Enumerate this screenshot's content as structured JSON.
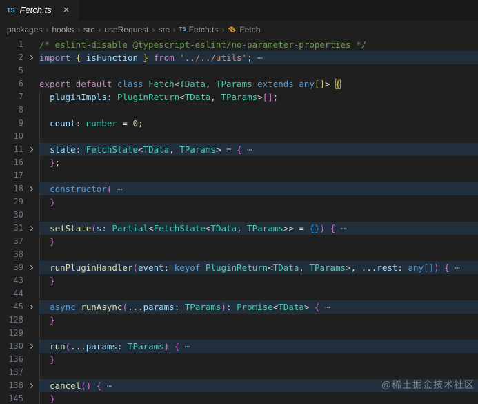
{
  "tab": {
    "icon": "TS",
    "title": "Fetch.ts",
    "close_label": "×"
  },
  "breadcrumb": {
    "separator": "›",
    "items": [
      {
        "label": "packages"
      },
      {
        "label": "hooks"
      },
      {
        "label": "src"
      },
      {
        "label": "useRequest"
      },
      {
        "label": "src"
      },
      {
        "label": "Fetch.ts",
        "icon": "typescript"
      },
      {
        "label": "Fetch",
        "icon": "class"
      }
    ]
  },
  "colors": {
    "editor_bg": "#1f1f1f",
    "tabstrip_bg": "#181818",
    "fold_highlight": "rgba(38,79,120,0.33)",
    "comment": "#6A9955",
    "keyword_control": "#C586C0",
    "keyword": "#569CD6",
    "type": "#4EC9B0",
    "variable": "#9CDCFE",
    "function": "#DCDCAA",
    "string": "#CE9178",
    "number_literal": "#B5CEA8",
    "punctuation": "#D4D4D4",
    "bracket_level1": "#FFD700",
    "bracket_level2": "#DA70D6",
    "bracket_level3": "#179FFF",
    "line_number": "#6e7681",
    "ts_icon": "#59a7d4",
    "class_icon": "#EE9D28"
  },
  "watermark": "@稀土掘金技术社区",
  "editor": {
    "lines": [
      {
        "num": "1",
        "seg": [
          [
            "/* eslint-disable @typescript-eslint/no-parameter-properties */",
            "comment"
          ]
        ]
      },
      {
        "num": "2",
        "fold": true,
        "hl": true,
        "seg": [
          [
            "import",
            "kwctl"
          ],
          [
            " ",
            "op"
          ],
          [
            "{",
            "b1"
          ],
          [
            " ",
            "op"
          ],
          [
            "isFunction",
            "var"
          ],
          [
            " ",
            "op"
          ],
          [
            "}",
            "b1"
          ],
          [
            " ",
            "op"
          ],
          [
            "from",
            "kwctl"
          ],
          [
            " ",
            "op"
          ],
          [
            "'../../utils'",
            "str"
          ],
          [
            ";",
            "op"
          ],
          [
            " ⋯",
            "fold"
          ]
        ]
      },
      {
        "num": "5",
        "seg": []
      },
      {
        "num": "6",
        "seg": [
          [
            "export",
            "kwctl"
          ],
          [
            " ",
            "op"
          ],
          [
            "default",
            "kwctl"
          ],
          [
            " ",
            "op"
          ],
          [
            "class",
            "kw"
          ],
          [
            " ",
            "op"
          ],
          [
            "Fetch",
            "type"
          ],
          [
            "<",
            "op"
          ],
          [
            "TData",
            "type"
          ],
          [
            ", ",
            "op"
          ],
          [
            "TParams",
            "type"
          ],
          [
            " ",
            "op"
          ],
          [
            "extends",
            "kw"
          ],
          [
            " ",
            "op"
          ],
          [
            "any",
            "kw"
          ],
          [
            "[]",
            "b1"
          ],
          [
            ">",
            "op"
          ],
          [
            " ",
            "op"
          ],
          [
            "{",
            "b1",
            "match"
          ]
        ]
      },
      {
        "num": "7",
        "guide": true,
        "seg": [
          [
            "  ",
            "op"
          ],
          [
            "pluginImpls",
            "var"
          ],
          [
            ":",
            "op"
          ],
          [
            " ",
            "op"
          ],
          [
            "PluginReturn",
            "type"
          ],
          [
            "<",
            "op"
          ],
          [
            "TData",
            "type"
          ],
          [
            ", ",
            "op"
          ],
          [
            "TParams",
            "type"
          ],
          [
            ">",
            "op"
          ],
          [
            "[]",
            "b2"
          ],
          [
            ";",
            "op"
          ]
        ]
      },
      {
        "num": "8",
        "guide": true,
        "seg": []
      },
      {
        "num": "9",
        "guide": true,
        "seg": [
          [
            "  ",
            "op"
          ],
          [
            "count",
            "var"
          ],
          [
            ":",
            "op"
          ],
          [
            " ",
            "op"
          ],
          [
            "number",
            "type"
          ],
          [
            " = ",
            "op"
          ],
          [
            "0",
            "num"
          ],
          [
            ";",
            "op"
          ]
        ]
      },
      {
        "num": "10",
        "guide": true,
        "seg": []
      },
      {
        "num": "11",
        "fold": true,
        "hl": true,
        "guide": true,
        "seg": [
          [
            "  ",
            "op"
          ],
          [
            "state",
            "var"
          ],
          [
            ":",
            "op"
          ],
          [
            " ",
            "op"
          ],
          [
            "FetchState",
            "type"
          ],
          [
            "<",
            "op"
          ],
          [
            "TData",
            "type"
          ],
          [
            ", ",
            "op"
          ],
          [
            "TParams",
            "type"
          ],
          [
            ">",
            "op"
          ],
          [
            " = ",
            "op"
          ],
          [
            "{",
            "b2"
          ],
          [
            " ⋯",
            "fold"
          ]
        ]
      },
      {
        "num": "16",
        "guide": true,
        "seg": [
          [
            "  ",
            "op"
          ],
          [
            "}",
            "b2"
          ],
          [
            ";",
            "op"
          ]
        ]
      },
      {
        "num": "17",
        "guide": true,
        "seg": []
      },
      {
        "num": "18",
        "fold": true,
        "hl": true,
        "guide": true,
        "seg": [
          [
            "  ",
            "op"
          ],
          [
            "constructor",
            "kw"
          ],
          [
            "(",
            "b2"
          ],
          [
            " ⋯",
            "fold"
          ]
        ]
      },
      {
        "num": "29",
        "guide": true,
        "seg": [
          [
            "  ",
            "op"
          ],
          [
            "}",
            "b2"
          ]
        ]
      },
      {
        "num": "30",
        "guide": true,
        "seg": []
      },
      {
        "num": "31",
        "fold": true,
        "hl": true,
        "guide": true,
        "seg": [
          [
            "  ",
            "op"
          ],
          [
            "setState",
            "fn"
          ],
          [
            "(",
            "b2"
          ],
          [
            "s",
            "var"
          ],
          [
            ":",
            "op"
          ],
          [
            " ",
            "op"
          ],
          [
            "Partial",
            "type"
          ],
          [
            "<",
            "op"
          ],
          [
            "FetchState",
            "type"
          ],
          [
            "<",
            "op"
          ],
          [
            "TData",
            "type"
          ],
          [
            ", ",
            "op"
          ],
          [
            "TParams",
            "type"
          ],
          [
            ">>",
            "op"
          ],
          [
            " = ",
            "op"
          ],
          [
            "{}",
            "b3"
          ],
          [
            ")",
            "b2"
          ],
          [
            " ",
            "op"
          ],
          [
            "{",
            "b2"
          ],
          [
            " ⋯",
            "fold"
          ]
        ]
      },
      {
        "num": "37",
        "guide": true,
        "seg": [
          [
            "  ",
            "op"
          ],
          [
            "}",
            "b2"
          ]
        ]
      },
      {
        "num": "38",
        "guide": true,
        "seg": []
      },
      {
        "num": "39",
        "fold": true,
        "hl": true,
        "guide": true,
        "seg": [
          [
            "  ",
            "op"
          ],
          [
            "runPluginHandler",
            "fn"
          ],
          [
            "(",
            "b2"
          ],
          [
            "event",
            "var"
          ],
          [
            ":",
            "op"
          ],
          [
            " ",
            "op"
          ],
          [
            "keyof",
            "kw"
          ],
          [
            " ",
            "op"
          ],
          [
            "PluginReturn",
            "type"
          ],
          [
            "<",
            "op"
          ],
          [
            "TData",
            "type"
          ],
          [
            ", ",
            "op"
          ],
          [
            "TParams",
            "type"
          ],
          [
            ">",
            "op"
          ],
          [
            ", ",
            "op"
          ],
          [
            "...",
            "op"
          ],
          [
            "rest",
            "var"
          ],
          [
            ":",
            "op"
          ],
          [
            " ",
            "op"
          ],
          [
            "any",
            "kw"
          ],
          [
            "[]",
            "b3"
          ],
          [
            ")",
            "b2"
          ],
          [
            " ",
            "op"
          ],
          [
            "{",
            "b2"
          ],
          [
            " ⋯",
            "fold"
          ]
        ]
      },
      {
        "num": "43",
        "guide": true,
        "seg": [
          [
            "  ",
            "op"
          ],
          [
            "}",
            "b2"
          ]
        ]
      },
      {
        "num": "44",
        "guide": true,
        "seg": []
      },
      {
        "num": "45",
        "fold": true,
        "hl": true,
        "guide": true,
        "seg": [
          [
            "  ",
            "op"
          ],
          [
            "async",
            "kw"
          ],
          [
            " ",
            "op"
          ],
          [
            "runAsync",
            "fn"
          ],
          [
            "(",
            "b2"
          ],
          [
            "...",
            "op"
          ],
          [
            "params",
            "var"
          ],
          [
            ":",
            "op"
          ],
          [
            " ",
            "op"
          ],
          [
            "TParams",
            "type"
          ],
          [
            ")",
            "b2"
          ],
          [
            ":",
            "op"
          ],
          [
            " ",
            "op"
          ],
          [
            "Promise",
            "type"
          ],
          [
            "<",
            "op"
          ],
          [
            "TData",
            "type"
          ],
          [
            ">",
            "op"
          ],
          [
            " ",
            "op"
          ],
          [
            "{",
            "b2"
          ],
          [
            " ⋯",
            "fold"
          ]
        ]
      },
      {
        "num": "128",
        "guide": true,
        "seg": [
          [
            "  ",
            "op"
          ],
          [
            "}",
            "b2"
          ]
        ]
      },
      {
        "num": "129",
        "guide": true,
        "seg": []
      },
      {
        "num": "130",
        "fold": true,
        "hl": true,
        "guide": true,
        "seg": [
          [
            "  ",
            "op"
          ],
          [
            "run",
            "fn"
          ],
          [
            "(",
            "b2"
          ],
          [
            "...",
            "op"
          ],
          [
            "params",
            "var"
          ],
          [
            ":",
            "op"
          ],
          [
            " ",
            "op"
          ],
          [
            "TParams",
            "type"
          ],
          [
            ")",
            "b2"
          ],
          [
            " ",
            "op"
          ],
          [
            "{",
            "b2"
          ],
          [
            " ⋯",
            "fold"
          ]
        ]
      },
      {
        "num": "136",
        "guide": true,
        "seg": [
          [
            "  ",
            "op"
          ],
          [
            "}",
            "b2"
          ]
        ]
      },
      {
        "num": "137",
        "guide": true,
        "seg": []
      },
      {
        "num": "138",
        "fold": true,
        "hl": true,
        "guide": true,
        "seg": [
          [
            "  ",
            "op"
          ],
          [
            "cancel",
            "fn"
          ],
          [
            "()",
            "b2"
          ],
          [
            " ",
            "op"
          ],
          [
            "{",
            "b2"
          ],
          [
            " ⋯",
            "fold"
          ]
        ]
      },
      {
        "num": "145",
        "guide": true,
        "seg": [
          [
            "  ",
            "op"
          ],
          [
            "}",
            "b2"
          ]
        ]
      }
    ]
  }
}
